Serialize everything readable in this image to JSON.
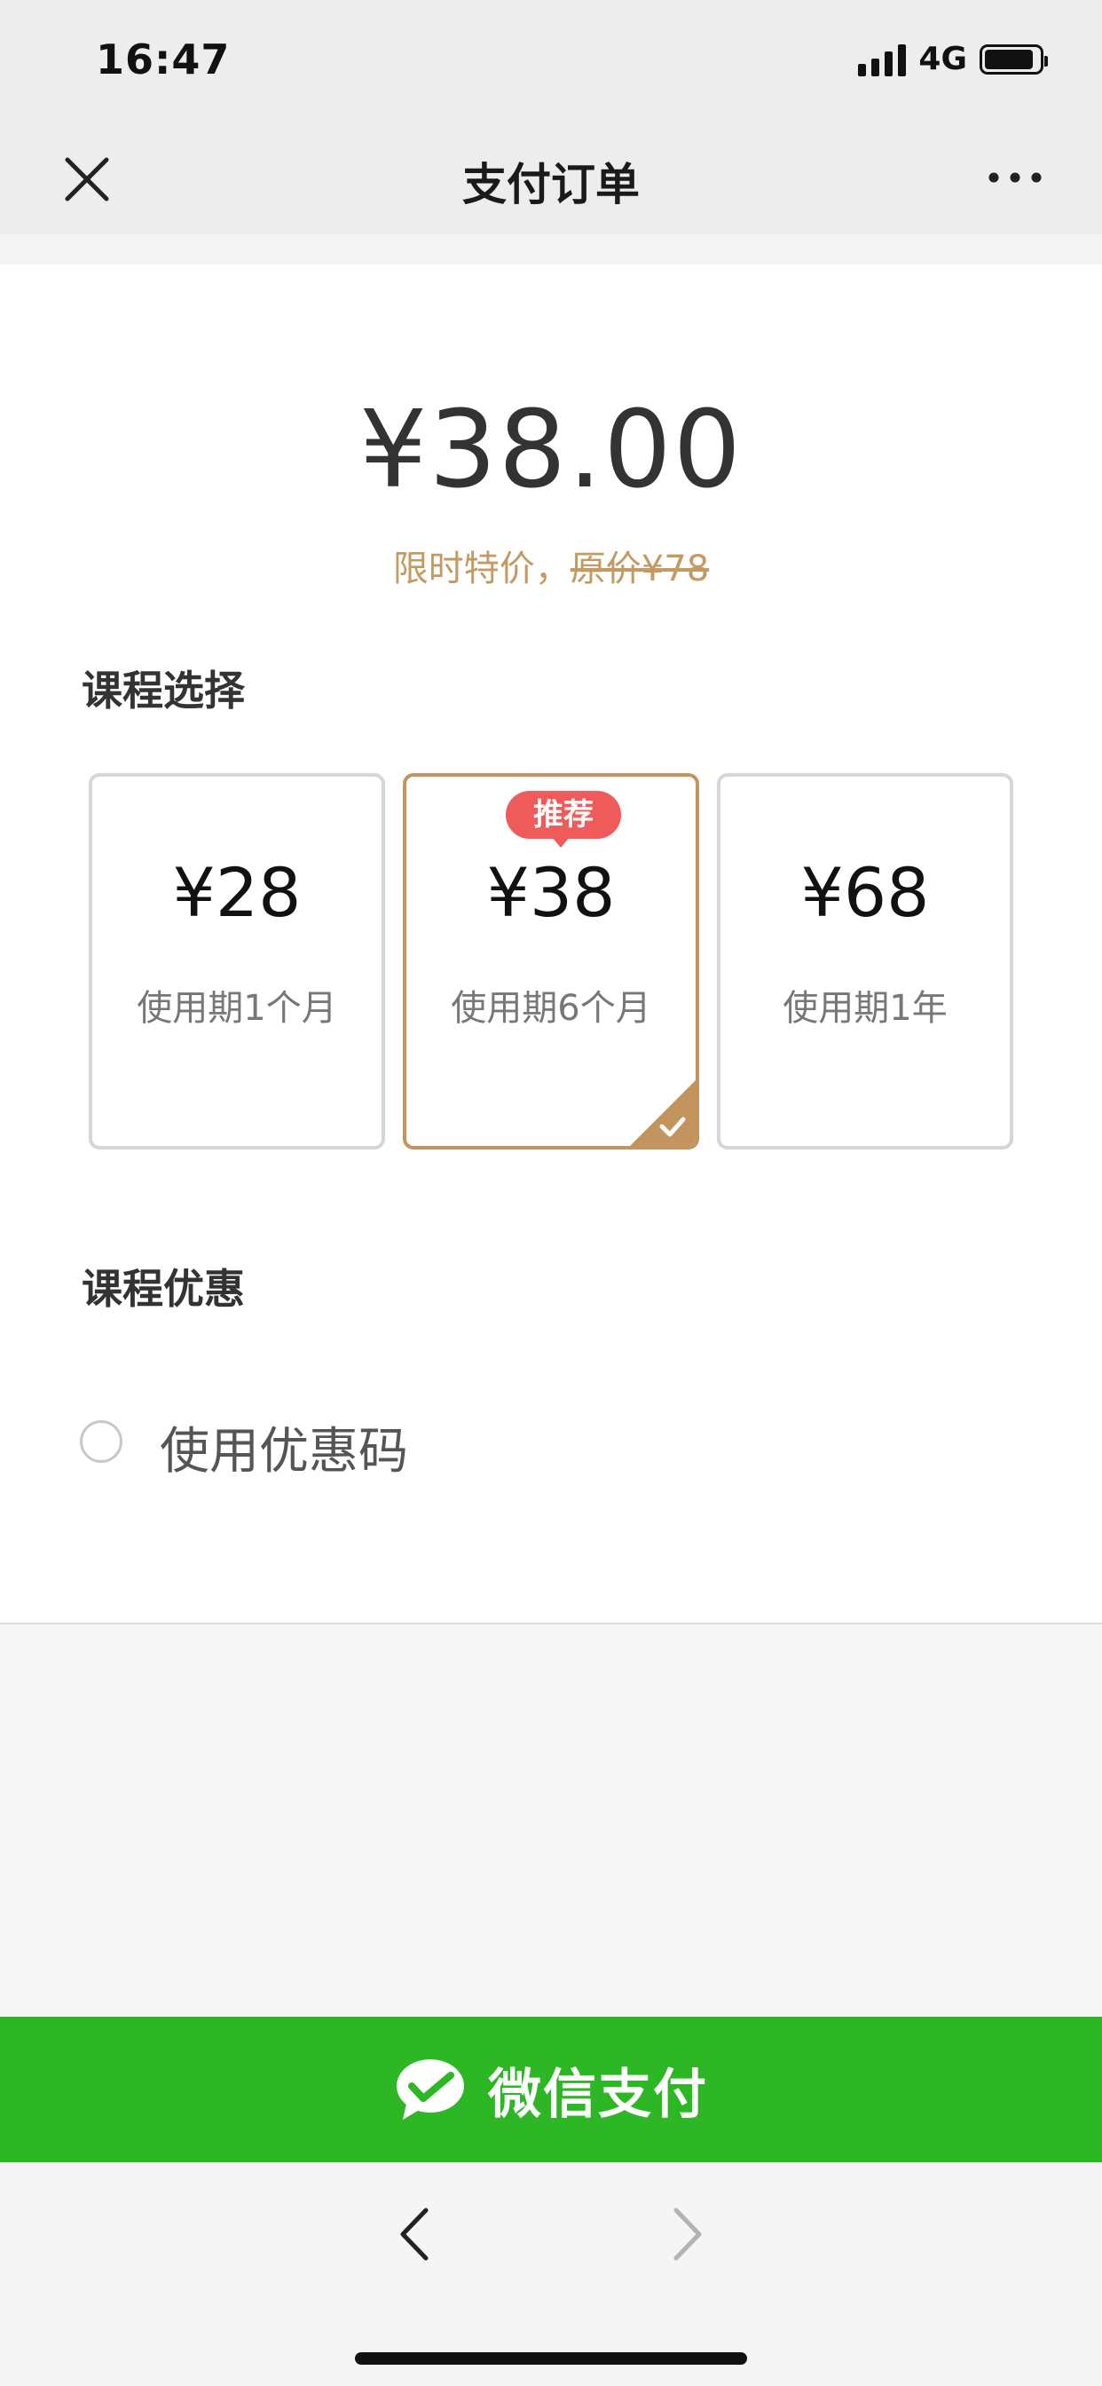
{
  "status_bar": {
    "time": "16:47",
    "network": "4G",
    "signal_icon": "signal-bars-icon",
    "battery_icon": "battery-icon"
  },
  "nav": {
    "title": "支付订单",
    "close_icon": "close-icon",
    "more_icon": "more-icon"
  },
  "price": {
    "current": "¥38.00",
    "note_prefix": "限时特价，",
    "note_original": "原价¥78"
  },
  "course_selection": {
    "title": "课程选择",
    "badge": "推荐",
    "plans": [
      {
        "price": "¥28",
        "desc": "使用期1个月",
        "selected": false
      },
      {
        "price": "¥38",
        "desc": "使用期6个月",
        "selected": true
      },
      {
        "price": "¥68",
        "desc": "使用期1年",
        "selected": false
      }
    ]
  },
  "course_discount": {
    "title": "课程优惠",
    "coupon_label": "使用优惠码",
    "coupon_checked": false
  },
  "pay": {
    "label": "微信支付",
    "icon": "wechat-pay-icon",
    "color": "#2db725"
  },
  "browser_nav": {
    "back_icon": "chevron-left-icon",
    "forward_icon": "chevron-right-icon"
  },
  "colors": {
    "accent_gold": "#c4945f",
    "badge_red": "#ef5a5a"
  }
}
